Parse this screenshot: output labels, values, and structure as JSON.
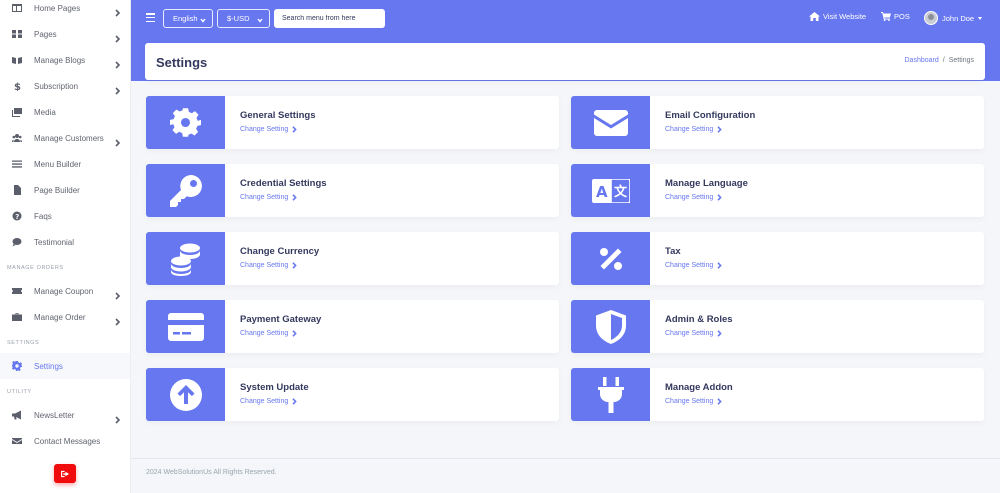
{
  "sidebar": {
    "items": [
      {
        "label": "Home Pages",
        "icon": "layout-icon",
        "has_chevron": true
      },
      {
        "label": "Pages",
        "icon": "grid-icon",
        "has_chevron": true
      },
      {
        "label": "Manage Blogs",
        "icon": "book-icon",
        "has_chevron": true
      },
      {
        "label": "Subscription",
        "icon": "dollar-icon",
        "has_chevron": true
      },
      {
        "label": "Media",
        "icon": "images-icon",
        "has_chevron": false
      },
      {
        "label": "Manage Customers",
        "icon": "users-icon",
        "has_chevron": true
      },
      {
        "label": "Menu Builder",
        "icon": "bars-icon",
        "has_chevron": false
      },
      {
        "label": "Page Builder",
        "icon": "file-icon",
        "has_chevron": false
      },
      {
        "label": "Faqs",
        "icon": "question-icon",
        "has_chevron": false
      },
      {
        "label": "Testimonial",
        "icon": "comment-icon",
        "has_chevron": false
      }
    ],
    "section_manage_orders": "MANAGE ORDERS",
    "orders_items": [
      {
        "label": "Manage Coupon",
        "icon": "ticket-icon",
        "has_chevron": true
      },
      {
        "label": "Manage Order",
        "icon": "briefcase-icon",
        "has_chevron": true
      }
    ],
    "section_settings": "SETTINGS",
    "settings_item": {
      "label": "Settings",
      "icon": "gear-icon",
      "active": true
    },
    "section_utility": "UTILITY",
    "utility_items": [
      {
        "label": "NewsLetter",
        "icon": "megaphone-icon",
        "has_chevron": true
      },
      {
        "label": "Contact Messages",
        "icon": "envelope-icon",
        "has_chevron": false
      }
    ],
    "logout_icon": "logout-icon"
  },
  "topbar": {
    "language": "English",
    "currency": "$-USD",
    "search_placeholder": "Search menu from here",
    "visit_website": "Visit Website",
    "pos": "POS",
    "user_name": "John Doe"
  },
  "header": {
    "title": "Settings",
    "breadcrumb_home": "Dashboard",
    "breadcrumb_sep": "/",
    "breadcrumb_current": "Settings"
  },
  "cards": [
    {
      "title": "General Settings",
      "link": "Change Setting",
      "icon": "gear-icon"
    },
    {
      "title": "Email Configuration",
      "link": "Change Setting",
      "icon": "envelope-icon"
    },
    {
      "title": "Credential Settings",
      "link": "Change Setting",
      "icon": "key-icon"
    },
    {
      "title": "Manage Language",
      "link": "Change Setting",
      "icon": "language-icon"
    },
    {
      "title": "Change Currency",
      "link": "Change Setting",
      "icon": "coins-icon"
    },
    {
      "title": "Tax",
      "link": "Change Setting",
      "icon": "percent-icon"
    },
    {
      "title": "Payment Gateway",
      "link": "Change Setting",
      "icon": "credit-card-icon"
    },
    {
      "title": "Admin & Roles",
      "link": "Change Setting",
      "icon": "shield-icon"
    },
    {
      "title": "System Update",
      "link": "Change Setting",
      "icon": "arrow-up-circle-icon"
    },
    {
      "title": "Manage Addon",
      "link": "Change Setting",
      "icon": "plug-icon"
    }
  ],
  "footer": {
    "copyright": "2024 WebSolutionUs All Rights Reserved."
  },
  "colors": {
    "primary": "#6777ef",
    "logout": "#f00c0c",
    "text": "#34395e"
  }
}
